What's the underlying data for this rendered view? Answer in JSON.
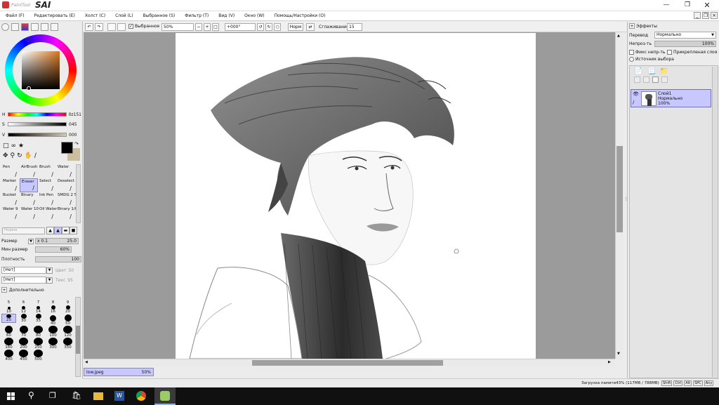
{
  "app": {
    "brand_small": "PaintTool",
    "brand_big": "SAI"
  },
  "menu": [
    "Файл (F)",
    "Редактировать (E)",
    "Холст (C)",
    "Слой (L)",
    "Выбранное (S)",
    "Фильтр (T)",
    "Вид (V)",
    "Окно (W)",
    "Помощь/Настройки (O)"
  ],
  "toolbar": {
    "selection_label": "Выбранное",
    "zoom_value": "50%",
    "rotation_value": "+000°",
    "mode_value": "Норм",
    "smoothing_label": "Сглаживание",
    "smoothing_value": "15"
  },
  "color": {
    "h_label": "H",
    "h_value": "0z151",
    "s_label": "S",
    "s_value": "045",
    "v_label": "V",
    "v_value": "000",
    "primary": "#000000",
    "secondary": "#cbbf9e"
  },
  "tools": [
    {
      "label": "Pen",
      "icon": "pen-icon"
    },
    {
      "label": "AirBrush",
      "icon": "airbrush-icon"
    },
    {
      "label": "Brush",
      "icon": "brush-icon"
    },
    {
      "label": "Water",
      "icon": "water-icon"
    },
    {
      "label": "Marker",
      "icon": "marker-icon"
    },
    {
      "label": "Eraser",
      "icon": "eraser-icon",
      "selected": true
    },
    {
      "label": "Select",
      "icon": "select-icon"
    },
    {
      "label": "Deselect",
      "icon": "deselect-icon"
    },
    {
      "label": "Bucket",
      "icon": "bucket-icon"
    },
    {
      "label": "Binary",
      "icon": "binary-icon"
    },
    {
      "label": "Ink Pen",
      "icon": "ink-pen-icon"
    },
    {
      "label": "SMDG 2 5",
      "icon": "smdg-icon"
    },
    {
      "label": "Water 9",
      "icon": "water-icon"
    },
    {
      "label": "Water 10",
      "icon": "water-icon"
    },
    {
      "label": "Oil Water",
      "icon": "oil-water-icon"
    },
    {
      "label": "Binary 1/0",
      "icon": "binary-icon"
    }
  ],
  "brush": {
    "mode_placeholder": "Норма",
    "size_label": "Размер",
    "size_mult": "x 0.1",
    "size_value": "25.0",
    "min_size_label": "Мин размер",
    "min_size_value": "60%",
    "density_label": "Плотность",
    "density_value": "100",
    "texture1": "[Нет]",
    "texture1_side": "Цвет",
    "texture1_val": "50",
    "texture2": "[Нет]",
    "texture2_side": "Текс",
    "texture2_val": "95",
    "advanced_label": "Дополнительно",
    "sizes": [
      "5",
      "6",
      "7",
      "8",
      "9",
      "10",
      "12",
      "14",
      "16",
      "20",
      "25",
      "30",
      "35",
      "40",
      "50",
      "60",
      "70",
      "80",
      "100",
      "120",
      "160",
      "200",
      "250",
      "300",
      "350",
      "400",
      "450",
      "500"
    ],
    "selected_size": "25"
  },
  "right_panel": {
    "effects_label": "Эффекты",
    "blend_label": "Перевод",
    "blend_value": "Нормально",
    "opacity_label": "Непроз-ть",
    "opacity_value": "100%",
    "check1": "Фикс непр-ть",
    "check2": "Прикрепленая слоя",
    "radio1": "Источник выбора",
    "layer_name": "Слой1",
    "layer_mode": "Нормально",
    "layer_opacity": "100%"
  },
  "document_tab": {
    "name": "low.jpeg",
    "zoom": "50%"
  },
  "status": {
    "memory": "Загрузка памяти43% (117MB / 788MB)",
    "keys": [
      "Shift",
      "Ctrl",
      "Alt",
      "SPC",
      "Any"
    ]
  },
  "taskbar": {
    "icons": [
      "windows-icon",
      "search-icon",
      "task-view-icon",
      "store-icon",
      "explorer-icon",
      "word-icon",
      "chrome-icon",
      "sai-icon"
    ]
  }
}
